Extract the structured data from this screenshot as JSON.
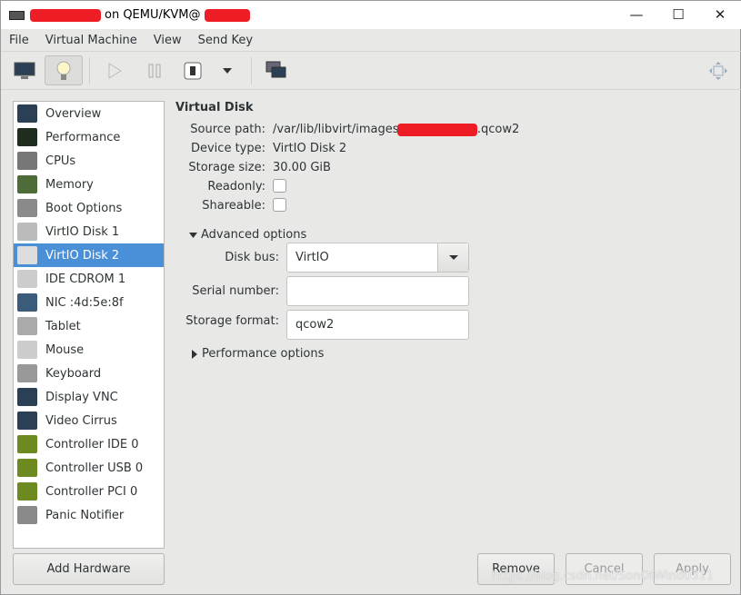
{
  "window": {
    "title_suffix": "on QEMU/KVM@",
    "minimize": "—",
    "maximize": "☐",
    "close": "✕"
  },
  "menu": [
    "File",
    "Virtual Machine",
    "View",
    "Send Key"
  ],
  "toolbar": {
    "icons": [
      "console-icon",
      "details-lightbulb-icon",
      "run-icon",
      "pause-icon",
      "shutdown-icon",
      "dropdown-icon",
      "snapshots-icon",
      "fullscreen-icon"
    ]
  },
  "sidebar": {
    "items": [
      {
        "label": "Overview",
        "icon": "monitor-icon",
        "color": "#2b3f55"
      },
      {
        "label": "Performance",
        "icon": "performance-icon",
        "color": "#1f2d1f"
      },
      {
        "label": "CPUs",
        "icon": "cpu-icon",
        "color": "#777777"
      },
      {
        "label": "Memory",
        "icon": "memory-icon",
        "color": "#4e6b3a"
      },
      {
        "label": "Boot Options",
        "icon": "gears-icon",
        "color": "#8a8a8a"
      },
      {
        "label": "VirtIO Disk 1",
        "icon": "disk-icon",
        "color": "#bbbbbb"
      },
      {
        "label": "VirtIO Disk 2",
        "icon": "disk-icon",
        "color": "#dddddd"
      },
      {
        "label": "IDE CDROM 1",
        "icon": "cdrom-icon",
        "color": "#cccccc"
      },
      {
        "label": "NIC :4d:5e:8f",
        "icon": "network-icon",
        "color": "#3b5b7a"
      },
      {
        "label": "Tablet",
        "icon": "tablet-icon",
        "color": "#aaaaaa"
      },
      {
        "label": "Mouse",
        "icon": "mouse-icon",
        "color": "#cccccc"
      },
      {
        "label": "Keyboard",
        "icon": "keyboard-icon",
        "color": "#999999"
      },
      {
        "label": "Display VNC",
        "icon": "display-icon",
        "color": "#2b3f55"
      },
      {
        "label": "Video Cirrus",
        "icon": "video-icon",
        "color": "#2b3f55"
      },
      {
        "label": "Controller IDE 0",
        "icon": "controller-icon",
        "color": "#6c8a1f"
      },
      {
        "label": "Controller USB 0",
        "icon": "controller-icon",
        "color": "#6c8a1f"
      },
      {
        "label": "Controller PCI 0",
        "icon": "controller-icon",
        "color": "#6c8a1f"
      },
      {
        "label": "Panic Notifier",
        "icon": "gears-icon",
        "color": "#8a8a8a"
      }
    ],
    "selected": "VirtIO Disk 2",
    "selected_color": "#4a90d9"
  },
  "details": {
    "heading": "Virtual Disk",
    "source_path_label": "Source path:",
    "source_path_prefix": "/var/lib/libvirt/images/",
    "source_path_suffix": ".qcow2",
    "device_type_label": "Device type:",
    "device_type": "VirtIO Disk 2",
    "storage_size_label": "Storage size:",
    "storage_size": "30.00 GiB",
    "readonly_label": "Readonly:",
    "readonly": false,
    "shareable_label": "Shareable:",
    "shareable": false,
    "advanced_label": "Advanced options",
    "disk_bus_label": "Disk bus:",
    "disk_bus": "VirtIO",
    "serial_label": "Serial number:",
    "serial": "",
    "format_label": "Storage format:",
    "format": "qcow2",
    "performance_label": "Performance options"
  },
  "buttons": {
    "add_hardware": "Add Hardware",
    "remove": "Remove",
    "cancel": "Cancel",
    "apply": "Apply"
  },
  "watermark": "https://blog.csdn.net/SonOfWind0311"
}
